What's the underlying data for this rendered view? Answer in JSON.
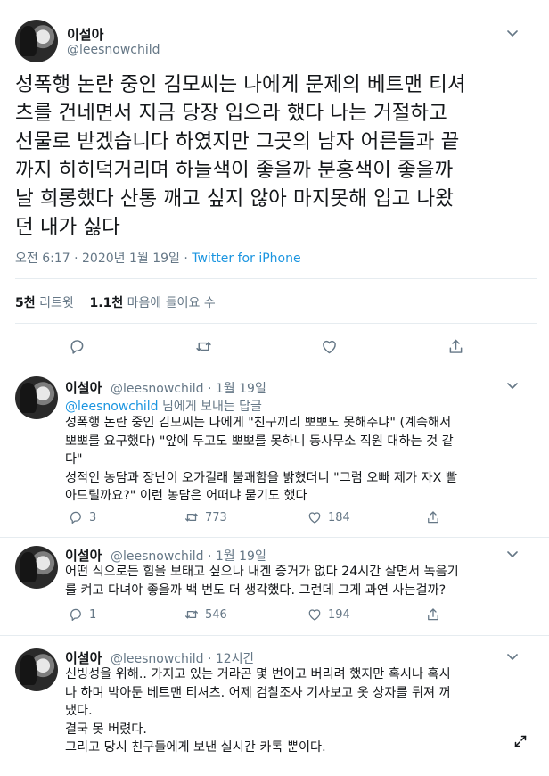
{
  "main_tweet": {
    "author_name": "이설아",
    "handle": "@leesnowchild",
    "menu_icon": "chevron-down-icon",
    "body_lines": [
      "성폭행 논란 중인 김모씨는 나에게 문제의 베트맨 티셔",
      "츠를 건네면서 지금 당장 입으라 했다 나는 거절하고",
      "선물로 받겠습니다 하였지만 그곳의 남자 어른들과 끝",
      "까지 히히덕거리며 하늘색이 좋을까 분홍색이 좋을까",
      "날 희롱했다 산통 깨고 싶지 않아 마지못해 입고 나왔",
      "던 내가 싫다"
    ],
    "timestamp": "오전 6:17 · 2020년 1월 19일 · ",
    "source": "Twitter for iPhone",
    "retweets_count": "5천",
    "retweets_label": " 리트윗",
    "likes_count": "1.1천",
    "likes_label": " 마음에 들어요 수",
    "actions": [
      "reply-icon",
      "retweet-icon",
      "like-icon",
      "share-icon"
    ]
  },
  "replies": [
    {
      "author_name": "이설아",
      "handle_time": "@leesnowchild · 1월 19일",
      "replying_to": "@leesnowchild",
      "replying_suffix": " 님에게 보내는 답글",
      "body_lines": [
        "성폭행 논란 중인 김모씨는 나에게 \"친구끼리 뽀뽀도 못해주냐\" (계속해서",
        "뽀뽀를 요구했다) \"앞에 두고도 뽀뽀를 못하니 동사무소 직원 대하는 것 같",
        "다\"",
        "성적인 농담과 장난이 오가길래 불쾌함을 밝혔더니 \"그럼 오빠 제가 자X 빨",
        "아드릴까요?\" 이런 농담은 어떠냐 묻기도 했다"
      ],
      "reply_count": "3",
      "retweet_count": "773",
      "like_count": "184"
    },
    {
      "author_name": "이설아",
      "handle_time": "@leesnowchild · 1월 19일",
      "body_lines": [
        "어떤 식으로든 힘을 보태고 싶으나 내겐 증거가 없다 24시간 살면서 녹음기",
        "를 켜고 다녀야 좋을까 백 번도 더 생각했다. 그런데 그게 과연 사는걸까?"
      ],
      "reply_count": "1",
      "retweet_count": "546",
      "like_count": "194"
    },
    {
      "author_name": "이설아",
      "handle_time": "@leesnowchild · 12시간",
      "body_lines": [
        "신빙성을 위해.. 가지고 있는 거라곤 몇 번이고 버리려 했지만 혹시나 혹시",
        "나 하며 박아둔 베트맨 티셔츠. 어제 검찰조사 기사보고 옷 상자를 뒤져 꺼",
        "냈다.",
        "결국 못 버렸다.",
        "그리고 당시 친구들에게 보낸 실시간 카톡 뿐이다."
      ]
    }
  ]
}
